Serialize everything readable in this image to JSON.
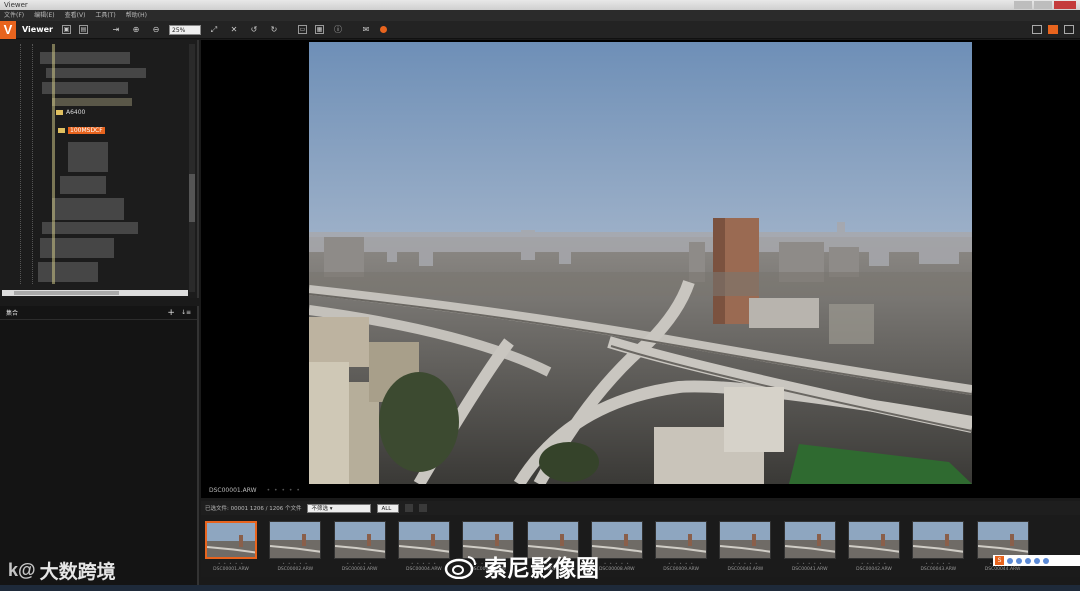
{
  "window": {
    "title": "Viewer"
  },
  "menu": [
    "文件(F)",
    "编辑(E)",
    "查看(V)",
    "工具(T)",
    "帮助(H)"
  ],
  "toolbar": {
    "app_label": "Viewer",
    "zoom_value": "25%",
    "icons": [
      "image-mode-icon",
      "copy-icon",
      "export-icon",
      "zoom-in-icon",
      "zoom-out-icon",
      "fit-icon",
      "fullscreen-icon",
      "rotate-left-icon",
      "rotate-right-icon",
      "compare-icon",
      "info-icon",
      "mail-icon"
    ]
  },
  "layout_buttons": [
    "grid-layout",
    "single-layout",
    "dual-layout"
  ],
  "folder_tree": {
    "items": [
      {
        "label": "A6400",
        "selected": false
      },
      {
        "label": "100MSDCF",
        "selected": true
      }
    ]
  },
  "collection_panel": {
    "title": "集合",
    "add_label": "+",
    "sort_label": "↓≡"
  },
  "status": {
    "filename": "DSC00001.ARW"
  },
  "filter_bar": {
    "text": "已选文件: 00001   1206 / 1206 个文件",
    "rating_filter": "不筛选",
    "label_filter": "ALL"
  },
  "filmstrip": {
    "selected_index": 0,
    "items": [
      "DSC00001.ARW",
      "DSC00002.ARW",
      "DSC00003.ARW",
      "DSC00004.ARW",
      "DSC00005.ARW",
      "DSC00006.ARW",
      "DSC00008.ARW",
      "DSC00009.ARW",
      "DSC00040.ARW",
      "DSC00041.ARW",
      "DSC00042.ARW",
      "DSC00043.ARW",
      "DSC00044.ARW"
    ]
  },
  "watermarks": {
    "left_text": "大数跨境",
    "left_mark": "k@",
    "center_text": "索尼影像圈"
  },
  "ime": {
    "label": "S"
  }
}
